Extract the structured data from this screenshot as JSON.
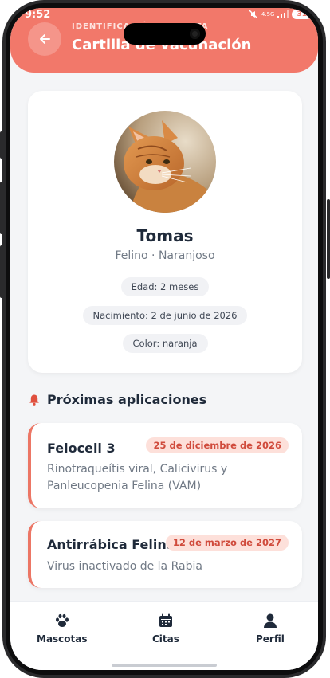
{
  "status_bar": {
    "time": "9:52",
    "network": "4.5G",
    "battery": "31"
  },
  "header": {
    "overline": "IDENTIFICACIÓN MASCOTA",
    "title": "Cartilla de vacunación",
    "back_icon": "arrow-left-icon"
  },
  "pet": {
    "name": "Tomas",
    "subtitle": "Felino · Naranjoso",
    "chips": {
      "age": "Edad: 2 meses",
      "birth": "Nacimiento: 2 de junio de 2026",
      "color": "Color: naranja"
    }
  },
  "upcoming": {
    "title": "Próximas aplicaciones",
    "icon": "bell-icon",
    "items": [
      {
        "name": "Felocell 3",
        "date": "25 de diciembre de 2026",
        "description": "Rinotraqueítis viral, Calicivirus y Panleucopenia Felina (VAM)"
      },
      {
        "name": "Antirrábica Felina",
        "date": "12 de marzo de 2027",
        "description": "Virus inactivado de la Rabia"
      }
    ]
  },
  "nav": {
    "items": [
      {
        "label": "Mascotas",
        "icon": "paw-icon"
      },
      {
        "label": "Citas",
        "icon": "calendar-icon"
      },
      {
        "label": "Perfil",
        "icon": "user-icon"
      }
    ]
  },
  "colors": {
    "accent": "#f2786a",
    "date_badge_bg": "#fde0da",
    "date_badge_text": "#d04b3c"
  }
}
